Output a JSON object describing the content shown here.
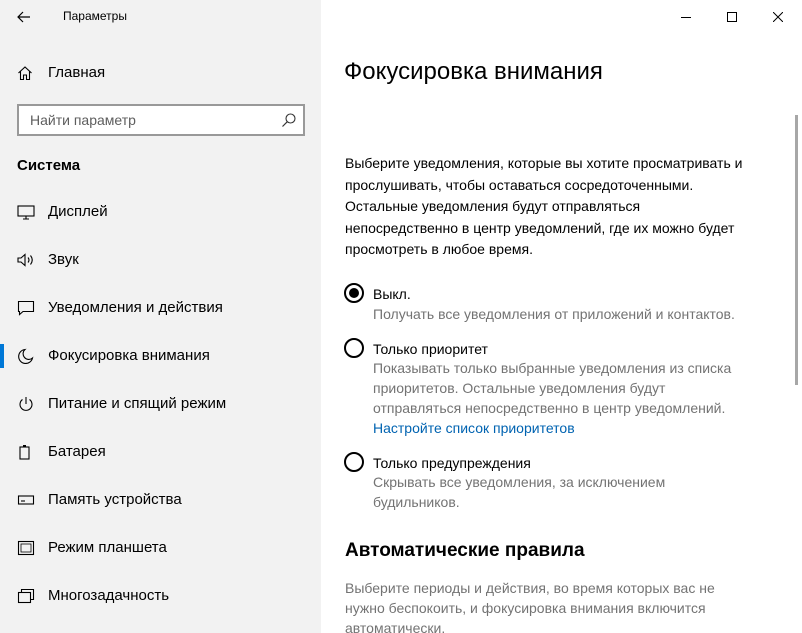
{
  "window": {
    "title": "Параметры"
  },
  "sidebar": {
    "home_label": "Главная",
    "search_placeholder": "Найти параметр",
    "section_title": "Система",
    "items": [
      {
        "label": "Дисплей",
        "icon": "monitor-icon"
      },
      {
        "label": "Звук",
        "icon": "speaker-icon"
      },
      {
        "label": "Уведомления и действия",
        "icon": "message-icon"
      },
      {
        "label": "Фокусировка внимания",
        "icon": "moon-icon",
        "active": true
      },
      {
        "label": "Питание и спящий режим",
        "icon": "power-icon"
      },
      {
        "label": "Батарея",
        "icon": "battery-icon"
      },
      {
        "label": "Память устройства",
        "icon": "storage-icon"
      },
      {
        "label": "Режим планшета",
        "icon": "tablet-icon"
      },
      {
        "label": "Многозадачность",
        "icon": "multitask-icon"
      }
    ]
  },
  "main": {
    "title": "Фокусировка внимания",
    "intro_lines": [
      "Выберите уведомления, которые вы хотите просматривать и",
      "прослушивать, чтобы оставаться сосредоточенными.",
      "Остальные уведомления будут отправляться",
      "непосредственно в центр уведомлений, где их можно будет",
      "просмотреть в любое время."
    ],
    "options": [
      {
        "label": "Выкл.",
        "checked": true,
        "desc_lines": [
          "Получать все уведомления от приложений и контактов."
        ]
      },
      {
        "label": "Только приоритет",
        "checked": false,
        "desc_lines": [
          "Показывать только выбранные уведомления из списка",
          "приоритетов. Остальные уведомления будут",
          "отправляться непосредственно в центр уведомлений."
        ],
        "link": "Настройте список приоритетов"
      },
      {
        "label": "Только предупреждения",
        "checked": false,
        "desc_lines": [
          "Скрывать все уведомления, за исключением",
          "будильников."
        ]
      }
    ],
    "auto_rules": {
      "title": "Автоматические правила",
      "desc_lines": [
        "Выберите периоды и действия, во время которых вас не",
        "нужно беспокоить, и фокусировка внимания включится",
        "автоматически."
      ]
    }
  },
  "colors": {
    "sidebar_bg": "#f2f2f2",
    "accent": "#0078d7",
    "link": "#0063b1",
    "secondary_text": "#737373"
  }
}
